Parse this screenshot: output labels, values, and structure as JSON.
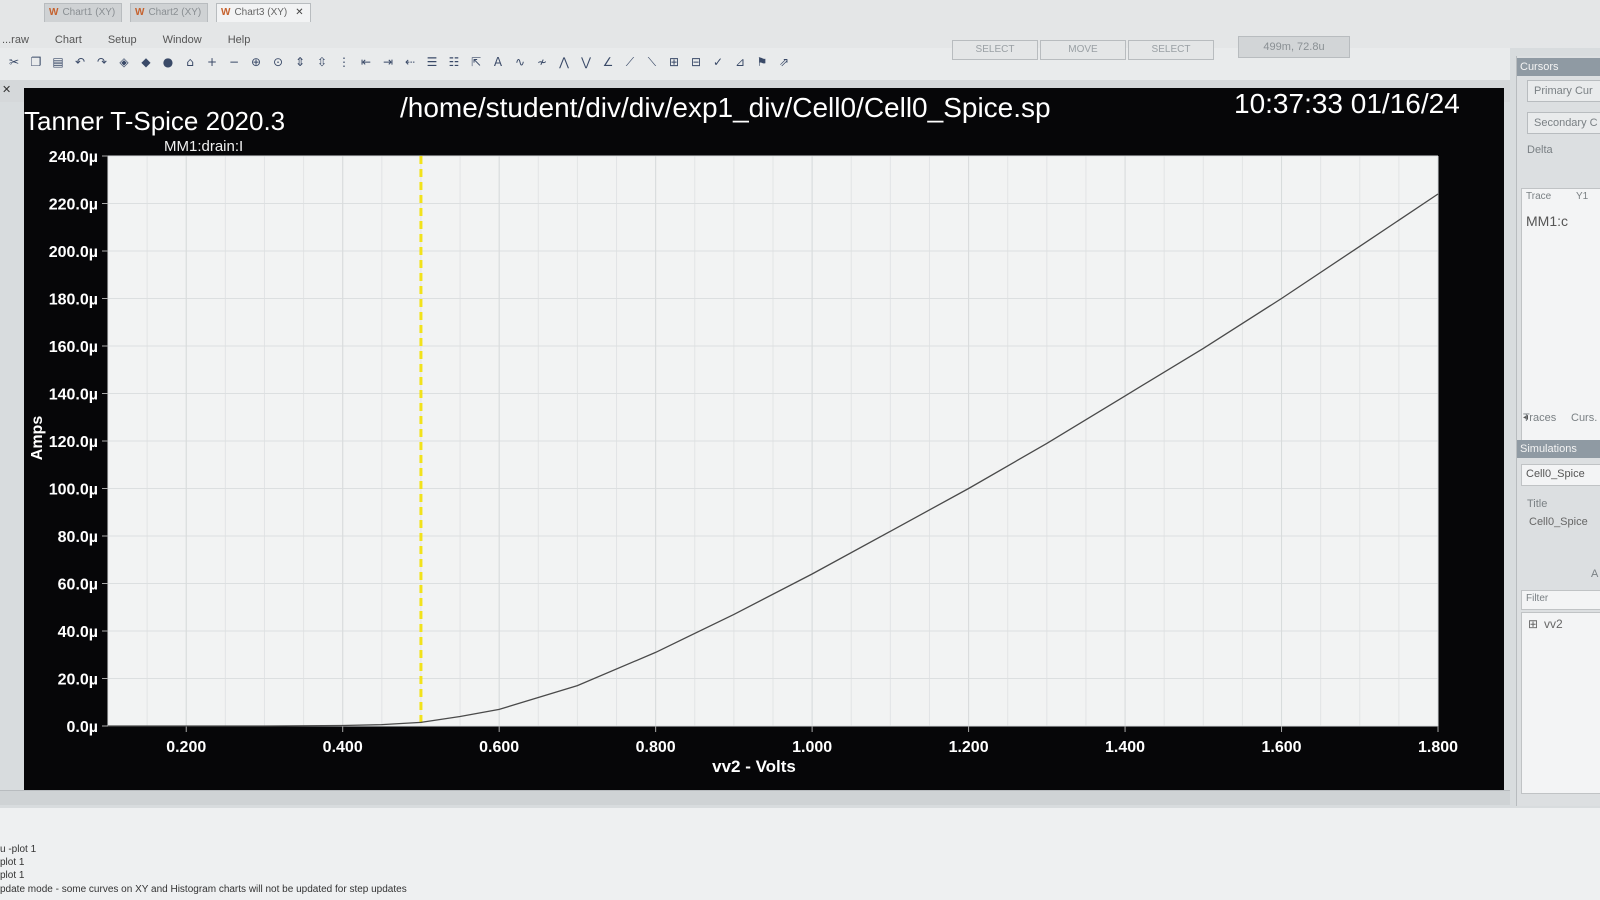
{
  "app": {
    "menu": [
      "...raw",
      "Chart",
      "Setup",
      "Window",
      "Help"
    ],
    "toolbar_buttons": [
      "SELECT",
      "MOVE",
      "SELECT"
    ],
    "readout": "499m, 72.8u",
    "tabs": [
      {
        "label": "Chart1 (XY)",
        "active": false
      },
      {
        "label": "Chart2 (XY)",
        "active": false
      },
      {
        "label": "Chart3 (XY)",
        "active": true
      }
    ]
  },
  "chart_header": {
    "program": "Tanner T-Spice 2020.3",
    "file_path": "/home/student/div/div/exp1_div/Cell0/Cell0_Spice.sp",
    "timestamp": "10:37:33 01/16/24",
    "trace_label": "MM1:drain:I"
  },
  "chart_data": {
    "type": "line",
    "xlabel": "vv2 - Volts",
    "ylabel": "Amps",
    "xlim": [
      0.1,
      1.8
    ],
    "ylim": [
      0,
      240
    ],
    "x_ticks": [
      0.2,
      0.4,
      0.6,
      0.8,
      1.0,
      1.2,
      1.4,
      1.6,
      1.8
    ],
    "x_tick_labels": [
      "0.200",
      "0.400",
      "0.600",
      "0.800",
      "1.000",
      "1.200",
      "1.400",
      "1.600",
      "1.800"
    ],
    "y_ticks": [
      0,
      20,
      40,
      60,
      80,
      100,
      120,
      140,
      160,
      180,
      200,
      220,
      240
    ],
    "y_tick_labels": [
      "0.0µ",
      "20.0µ",
      "40.0µ",
      "60.0µ",
      "80.0µ",
      "100.0µ",
      "120.0µ",
      "140.0µ",
      "160.0µ",
      "180.0µ",
      "200.0µ",
      "220.0µ",
      "240.0µ"
    ],
    "grid": true,
    "series": [
      {
        "x": [
          0.1,
          0.2,
          0.3,
          0.4,
          0.45,
          0.5,
          0.55,
          0.6,
          0.7,
          0.8,
          0.9,
          1.0,
          1.1,
          1.2,
          1.3,
          1.4,
          1.5,
          1.6,
          1.7,
          1.8
        ],
        "y": [
          0,
          0,
          0,
          0.2,
          0.6,
          1.5,
          4,
          7,
          17,
          31,
          47,
          64,
          82,
          100,
          119,
          139,
          159,
          180,
          202,
          224
        ],
        "color": "#4a4a4a"
      }
    ],
    "cursor_x": 0.5,
    "cursor_color": "#f2e21a"
  },
  "right_panel": {
    "cursors_header": "Cursors",
    "primary_button": "Primary Cur",
    "secondary_button": "Secondary C",
    "delta_label": "Delta",
    "trace_col": "Trace",
    "y1_col": "Y1",
    "trace_value": "MM1:c",
    "bottom_tabs": [
      "Traces",
      "Curs."
    ],
    "simulations_header": "Simulations",
    "simulation_name": "Cell0_Spice",
    "title_label": "Title",
    "title_value": "Cell0_Spice",
    "a_label": "A",
    "filter_label": "Filter",
    "tree_item": "vv2"
  },
  "status_lines": [
    "u -plot 1",
    "plot 1",
    "plot 1",
    "pdate mode - some curves on XY and Histogram charts will not be updated for step updates"
  ]
}
